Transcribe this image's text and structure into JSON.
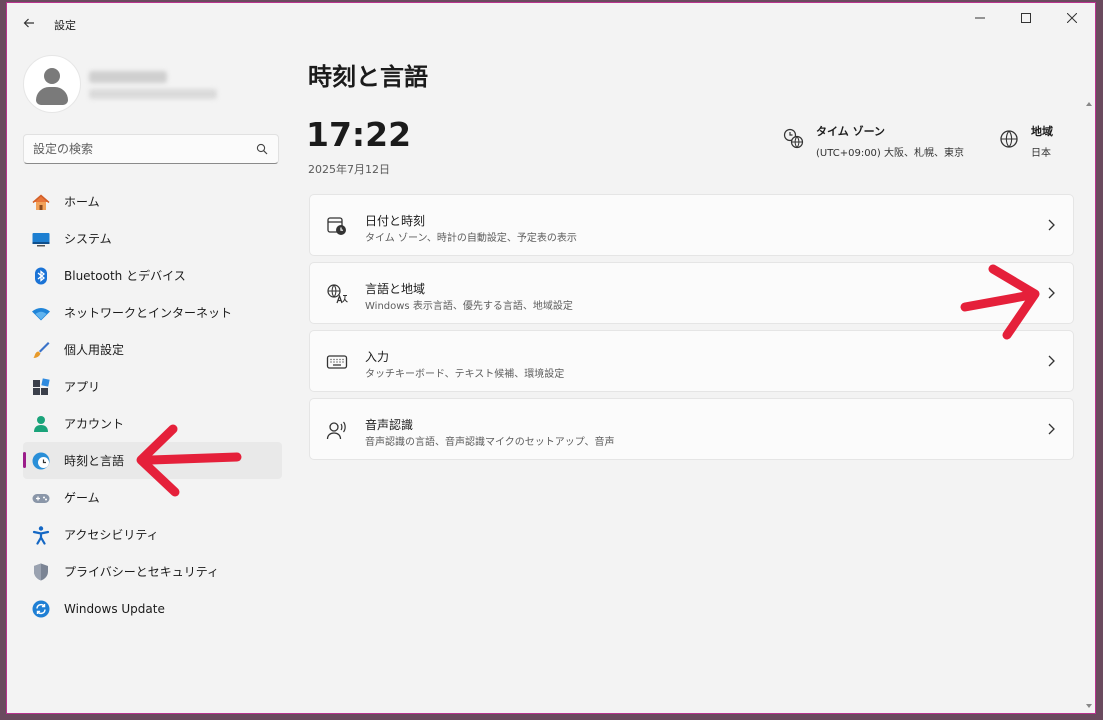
{
  "app": {
    "title": "設定"
  },
  "search": {
    "placeholder": "設定の検索"
  },
  "sidebar": {
    "items": [
      {
        "label": "ホーム"
      },
      {
        "label": "システム"
      },
      {
        "label": "Bluetooth とデバイス"
      },
      {
        "label": "ネットワークとインターネット"
      },
      {
        "label": "個人用設定"
      },
      {
        "label": "アプリ"
      },
      {
        "label": "アカウント"
      },
      {
        "label": "時刻と言語",
        "selected": true
      },
      {
        "label": "ゲーム"
      },
      {
        "label": "アクセシビリティ"
      },
      {
        "label": "プライバシーとセキュリティ"
      },
      {
        "label": "Windows Update"
      }
    ]
  },
  "main": {
    "title": "時刻と言語",
    "time": "17:22",
    "date": "2025年7月12日",
    "timezone": {
      "title": "タイム ゾーン",
      "value": "(UTC+09:00) 大阪、札幌、東京"
    },
    "region": {
      "title": "地域",
      "value": "日本"
    },
    "cards": [
      {
        "title": "日付と時刻",
        "subtitle": "タイム ゾーン、時計の自動設定、予定表の表示"
      },
      {
        "title": "言語と地域",
        "subtitle": "Windows 表示言語、優先する言語、地域設定"
      },
      {
        "title": "入力",
        "subtitle": "タッチキーボード、テキスト候補、環境設定"
      },
      {
        "title": "音声認識",
        "subtitle": "音声認識の言語、音声認識マイクのセットアップ、音声"
      }
    ]
  },
  "colors": {
    "accent": "#9b1d8a",
    "annotation": "#e5203a"
  }
}
